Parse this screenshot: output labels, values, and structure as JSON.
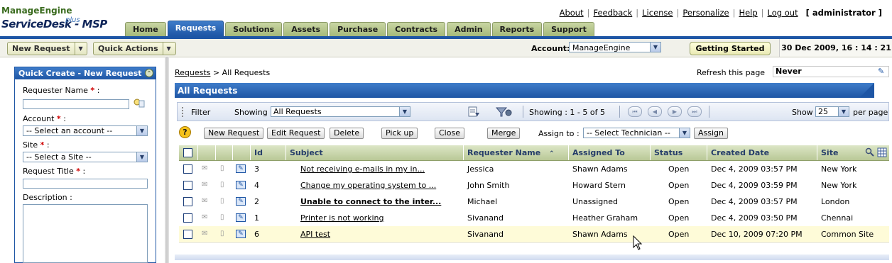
{
  "header": {
    "brand_line1": "ManageEngine",
    "brand_line2": "ServiceDesk - MSP",
    "brand_sup": "plus",
    "links": [
      "About",
      "Feedback",
      "License",
      "Personalize",
      "Help",
      "Log out"
    ],
    "user": "[ administrator ]",
    "tabs": [
      "Home",
      "Requests",
      "Solutions",
      "Assets",
      "Purchase",
      "Contracts",
      "Admin",
      "Reports",
      "Support"
    ],
    "active_tab": "Requests"
  },
  "toolbar": {
    "new_request": "New Request",
    "quick_actions": "Quick Actions",
    "account_label": "Account:",
    "account_value": "ManageEngine",
    "getting_started": "Getting Started",
    "datetime": "30 Dec 2009, 16 : 14 : 21"
  },
  "quick_create": {
    "title": "Quick Create - New Request",
    "requester_name_label": "Requester Name",
    "account_label": "Account",
    "account_placeholder": "-- Select an account --",
    "site_label": "Site",
    "site_placeholder": "-- Select a Site --",
    "request_title_label": "Request Title",
    "description_label": "Description :",
    "required_mark": "*",
    "colon": ":"
  },
  "main": {
    "breadcrumb_link": "Requests",
    "breadcrumb_rest": " > All Requests",
    "refresh_label": "Refresh this page",
    "refresh_value": "Never",
    "section_title": "All Requests",
    "filter_label": "Filter",
    "showing_label": "Showing",
    "showing_value": "All Requests",
    "pagination": "Showing : 1 - 5 of 5",
    "show_label": "Show",
    "per_page_value": "25",
    "per_page_label": "per page",
    "actions": [
      "New Request",
      "Edit Request",
      "Delete",
      "Pick up",
      "Close",
      "Merge"
    ],
    "assign_to_label": "Assign to :",
    "technician_placeholder": "-- Select Technician --",
    "assign_button": "Assign"
  },
  "table": {
    "columns": [
      "Id",
      "Subject",
      "Requester Name",
      "Assigned To",
      "Status",
      "Created Date",
      "Site"
    ],
    "sort_indicator": "≈",
    "rows": [
      {
        "id": "3",
        "subject": "Not receiving e-mails in my in...",
        "requester": "Jessica",
        "assigned": "Shawn Adams",
        "status": "Open",
        "created": "Dec 4, 2009 03:57 PM",
        "site": "New York",
        "bold": false
      },
      {
        "id": "4",
        "subject": "Change my operating system to ...",
        "requester": "John Smith",
        "assigned": "Howard Stern",
        "status": "Open",
        "created": "Dec 4, 2009 03:59 PM",
        "site": "New York",
        "bold": false
      },
      {
        "id": "2",
        "subject": "Unable to connect to the inter...",
        "requester": "Michael",
        "assigned": "Unassigned",
        "status": "Open",
        "created": "Dec 4, 2009 03:57 PM",
        "site": "London",
        "bold": true
      },
      {
        "id": "1",
        "subject": "Printer is not working",
        "requester": "Sivanand",
        "assigned": "Heather Graham",
        "status": "Open",
        "created": "Dec 4, 2009 03:50 PM",
        "site": "Chennai",
        "bold": false
      },
      {
        "id": "6",
        "subject": "API test",
        "requester": "Sivanand",
        "assigned": "Shawn Adams",
        "status": "Open",
        "created": "Dec 10, 2009 07:20 PM",
        "site": "Common Site",
        "bold": false
      }
    ]
  }
}
